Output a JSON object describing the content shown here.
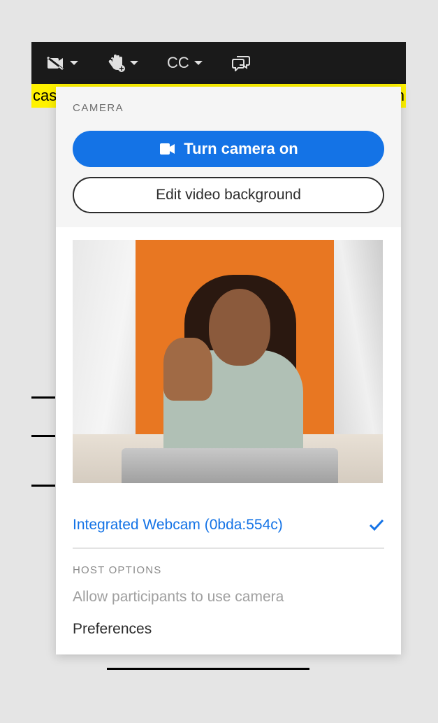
{
  "toolbar": {
    "cc_label": "CC"
  },
  "yellow_bar": {
    "left_text": "cas",
    "right_text": "an"
  },
  "dropdown": {
    "title": "CAMERA",
    "turn_on_label": "Turn camera on",
    "edit_bg_label": "Edit video background",
    "device": {
      "name": "Integrated Webcam (0bda:554c)",
      "selected": true
    },
    "host": {
      "title": "HOST OPTIONS",
      "allow_label": "Allow participants to use camera",
      "preferences_label": "Preferences"
    }
  }
}
